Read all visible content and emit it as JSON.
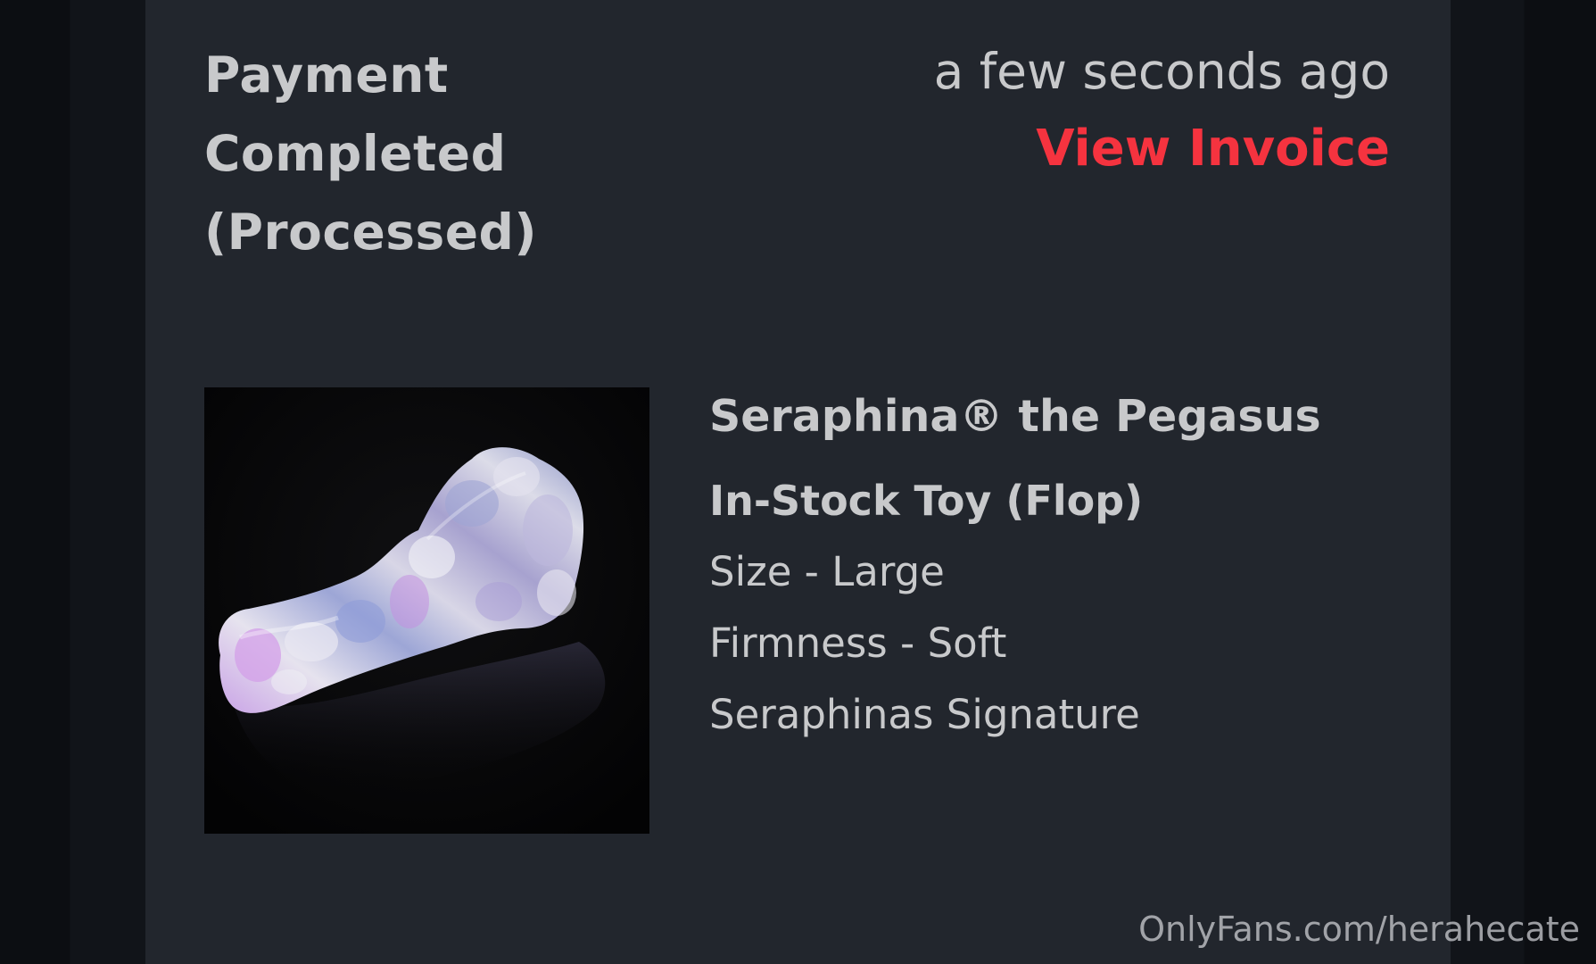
{
  "order": {
    "status_lines": [
      "Payment",
      "Completed",
      "(Processed)"
    ],
    "timestamp": "a few seconds ago",
    "view_invoice_label": "View Invoice"
  },
  "product": {
    "name": "Seraphina® the Pegasus",
    "variant": "In-Stock Toy (Flop)",
    "options": [
      "Size - Large",
      "Firmness - Soft",
      "Seraphinas Signature"
    ]
  },
  "watermark": "OnlyFans.com/herahecate",
  "colors": {
    "background": "#0c0e12",
    "card": "#22262d",
    "text": "#c8c9cb",
    "accent": "#f5333f"
  }
}
